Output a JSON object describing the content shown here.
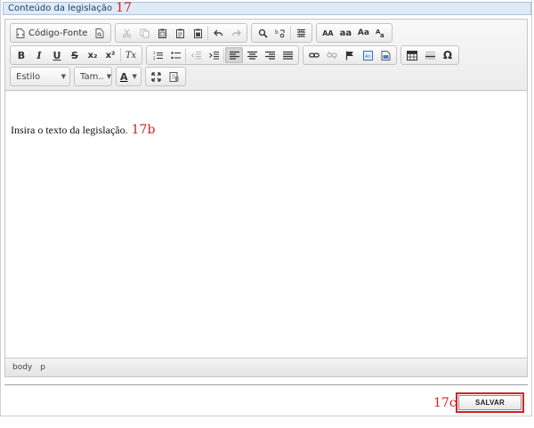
{
  "section": {
    "title": "Conteúdo da legislação",
    "annotation": "17"
  },
  "toolbar": {
    "source_label": "Código-Fonte",
    "style_combo": "Estilo",
    "size_combo": "Tam..",
    "font_color_label": "A",
    "uppercase_label": "AA",
    "lowercase_label": "aa",
    "capitalize_label": "Aa",
    "bold_label": "B",
    "italic_label": "I",
    "underline_label": "U",
    "strike_label": "S",
    "subscript_label": "x₂",
    "superscript_label": "x²",
    "remove_format_label": "Tx",
    "special_char_label": "Ω"
  },
  "editor": {
    "content": "Insira o texto da legislação.",
    "annotation": "17b"
  },
  "path_bar": {
    "items": [
      "body",
      "p"
    ]
  },
  "footer": {
    "annotation": "17c",
    "save_label": "SALVAR"
  },
  "colors": {
    "annotation_red": "#d42222",
    "header_bg": "#dfeaf7",
    "header_border": "#a9c2e0"
  }
}
